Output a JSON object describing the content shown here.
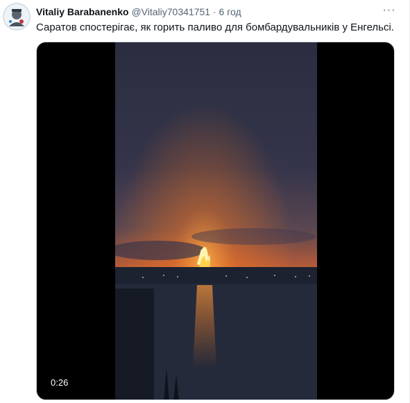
{
  "author": {
    "display_name": "Vitaliy Barabanenko",
    "handle": "@Vitaliy70341751",
    "separator": "·",
    "time_ago": "6 год"
  },
  "tweet": {
    "text": "Саратов спостерігає, як горить паливо для бомбардувальників у Енгельсі."
  },
  "media": {
    "type": "video",
    "duration": "0:26"
  },
  "icons": {
    "more": "more-options-icon"
  },
  "colors": {
    "name": "#0f1419",
    "secondary": "#536471",
    "fire": "#ff8a1c",
    "sky_dark": "#2c3044"
  }
}
